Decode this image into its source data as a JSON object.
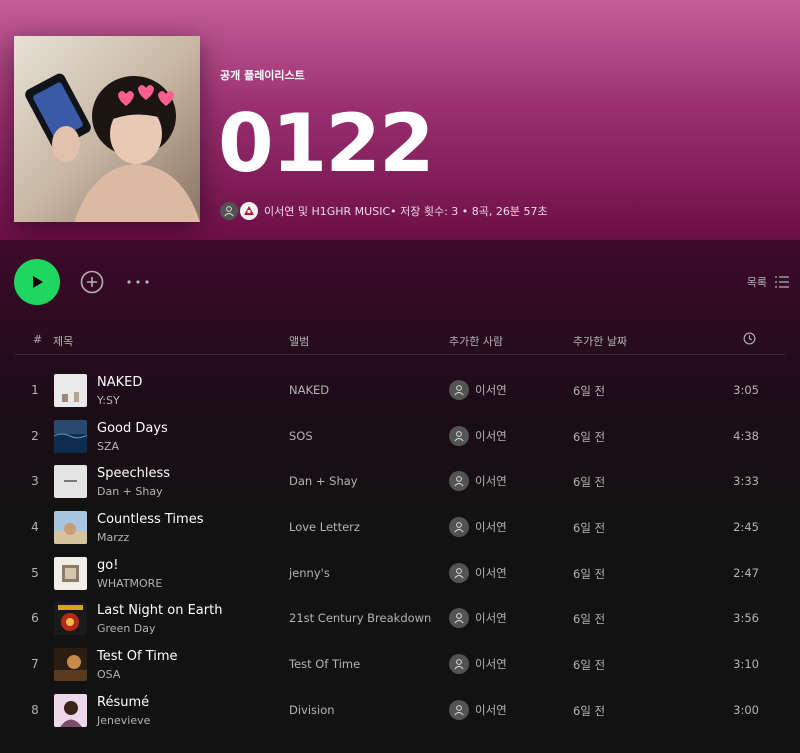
{
  "playlist": {
    "type_label": "공개 플레이리스트",
    "title": "0122",
    "owners": "이서연 및 H1GHR MUSIC",
    "stats": " • 저장 횟수: 3 • 8곡, 26분 57초"
  },
  "colors": {
    "accent": "#1ed760",
    "hero_top": "#c35f9a",
    "hero_bottom": "#6c0e47",
    "background": "#121212"
  },
  "actions": {
    "play_icon": "play-icon",
    "add_icon": "add-circle-icon",
    "more_icon": "more-dots-icon",
    "view_label": "목록",
    "view_icon": "list-icon"
  },
  "columns": {
    "number": "#",
    "title": "제목",
    "album": "앨범",
    "added_by": "추가한 사람",
    "date_added": "추가한 날짜",
    "duration_icon": "clock-icon"
  },
  "tracks": [
    {
      "num": "1",
      "title": "NAKED",
      "artist": "Y:SY",
      "album": "NAKED",
      "added_by": "이서연",
      "date": "6일 전",
      "duration": "3:05"
    },
    {
      "num": "2",
      "title": "Good Days",
      "artist": "SZA",
      "album": "SOS",
      "added_by": "이서연",
      "date": "6일 전",
      "duration": "4:38"
    },
    {
      "num": "3",
      "title": "Speechless",
      "artist": "Dan + Shay",
      "album": "Dan + Shay",
      "added_by": "이서연",
      "date": "6일 전",
      "duration": "3:33"
    },
    {
      "num": "4",
      "title": "Countless Times",
      "artist": "Marzz",
      "album": "Love Letterz",
      "added_by": "이서연",
      "date": "6일 전",
      "duration": "2:45"
    },
    {
      "num": "5",
      "title": "go!",
      "artist": "WHATMORE",
      "album": "jenny's",
      "added_by": "이서연",
      "date": "6일 전",
      "duration": "2:47"
    },
    {
      "num": "6",
      "title": "Last Night on Earth",
      "artist": "Green Day",
      "album": "21st Century Breakdown",
      "added_by": "이서연",
      "date": "6일 전",
      "duration": "3:56"
    },
    {
      "num": "7",
      "title": "Test Of Time",
      "artist": "OSA",
      "album": "Test Of Time",
      "added_by": "이서연",
      "date": "6일 전",
      "duration": "3:10"
    },
    {
      "num": "8",
      "title": "Résumé",
      "artist": "Jenevieve",
      "album": "Division",
      "added_by": "이서연",
      "date": "6일 전",
      "duration": "3:00"
    }
  ]
}
